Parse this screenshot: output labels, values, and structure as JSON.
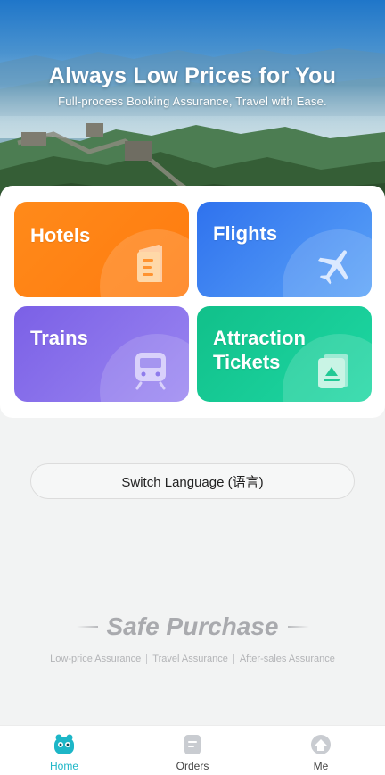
{
  "hero": {
    "title": "Always Low Prices for You",
    "subtitle": "Full-process Booking Assurance, Travel with Ease."
  },
  "services": [
    {
      "label": "Hotels",
      "icon": "hotel-icon",
      "color": "#ff7e12"
    },
    {
      "label": "Flights",
      "icon": "plane-icon",
      "color": "#3f85f2"
    },
    {
      "label": "Trains",
      "icon": "train-icon",
      "color": "#8670ea"
    },
    {
      "label": "Attraction\nTickets",
      "icon": "ticket-icon",
      "color": "#14c893"
    }
  ],
  "language_button": "Switch Language (语言)",
  "safe": {
    "title": "Safe Purchase",
    "items": [
      "Low-price Assurance",
      "Travel Assurance",
      "After-sales Assurance"
    ]
  },
  "tabbar": {
    "items": [
      {
        "label": "Home",
        "icon": "home-mascot-icon",
        "active": true
      },
      {
        "label": "Orders",
        "icon": "orders-icon",
        "active": false
      },
      {
        "label": "Me",
        "icon": "profile-icon",
        "active": false
      }
    ],
    "active_color": "#1db6c7"
  }
}
